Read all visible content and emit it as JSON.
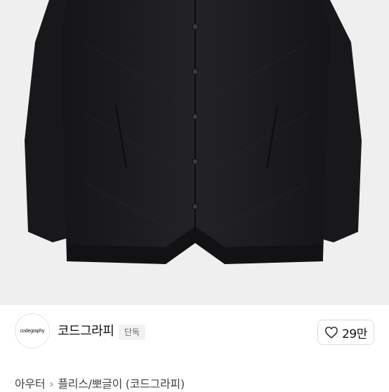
{
  "product_image": {
    "alt": "검정 퀼팅 자켓"
  },
  "brand": {
    "logo_text": "codegraphy",
    "name": "코드그라피",
    "badge": "단독"
  },
  "like": {
    "count": "29만",
    "icon": "heart-outline-icon"
  },
  "breadcrumb": {
    "items": [
      "아우터",
      "플리스/뽀글이 (코드그라피)"
    ],
    "separator": "›"
  },
  "colors": {
    "jacket": "#1c1c1e",
    "photo_background": "#efefef",
    "badge_background": "#f2f2f2",
    "border": "#dcdcdc"
  }
}
